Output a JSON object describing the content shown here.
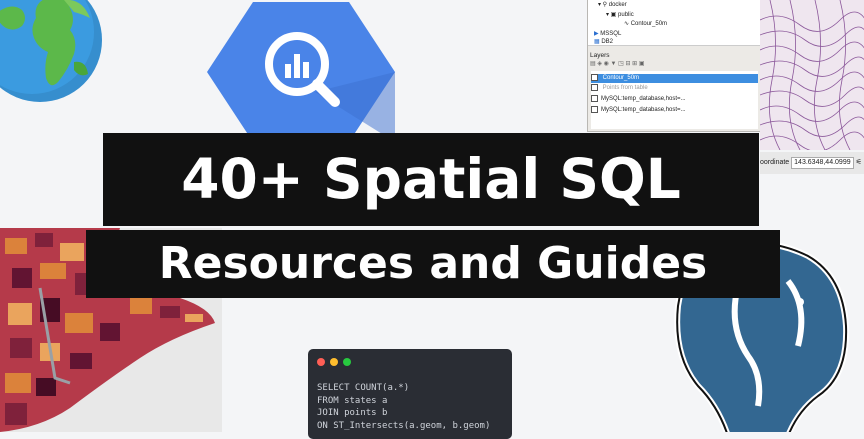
{
  "title": {
    "line1": "40+ Spatial SQL",
    "line2": "Resources and Guides"
  },
  "qgis": {
    "tree": [
      "docker",
      "public",
      "Contour_50m",
      "MSSQL",
      "DB2"
    ],
    "layers_header": "Layers",
    "layers": [
      "Contour_50m",
      "Points from table",
      "MySQL:temp_database,host=...",
      "MySQL:temp_database,host=..."
    ]
  },
  "map": {
    "coordinate_label": "oordinate",
    "coordinate_value": "143.6348,44.0999"
  },
  "code": {
    "lines": [
      "SELECT COUNT(a.*)",
      "FROM states a",
      "JOIN points b",
      "ON ST_Intersects(a.geom, b.geom)"
    ]
  },
  "icons": [
    "globe-icon",
    "bigquery-icon",
    "postgres-elephant-icon"
  ],
  "colors": {
    "banner": "#111111",
    "bigquery": "#4a84e8",
    "postgres": "#336791",
    "code_bg": "#2a2d34",
    "dot_red": "#ff5f56",
    "dot_yellow": "#ffbd2e",
    "dot_green": "#27c93f"
  }
}
